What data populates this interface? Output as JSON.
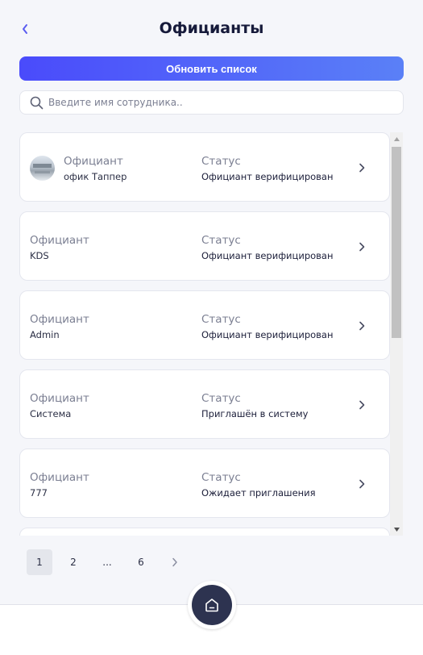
{
  "header": {
    "title": "Официанты",
    "back_icon": "chevron-left-icon",
    "accent_color": "#5a5cf0"
  },
  "refresh_button": {
    "label": "Обновить список",
    "gradient": [
      "#4a4bfb",
      "#5a80f7"
    ]
  },
  "search": {
    "placeholder": "Введите имя сотрудника..",
    "value": "",
    "icon": "search-icon"
  },
  "waiters": [
    {
      "role_label": "Официант",
      "name": "офик Таппер",
      "status_label": "Статус",
      "status": "Официант верифицирован",
      "has_avatar": true
    },
    {
      "role_label": "Официант",
      "name": "KDS",
      "status_label": "Статус",
      "status": "Официант верифицирован",
      "has_avatar": false
    },
    {
      "role_label": "Официант",
      "name": "Admin",
      "status_label": "Статус",
      "status": "Официант верифицирован",
      "has_avatar": false
    },
    {
      "role_label": "Официант",
      "name": "Система",
      "status_label": "Статус",
      "status": "Приглашён в систему",
      "has_avatar": false
    },
    {
      "role_label": "Официант",
      "name": "777",
      "status_label": "Статус",
      "status": "Ожидает приглашения",
      "has_avatar": false
    }
  ],
  "pagination": {
    "pages": [
      "1",
      "2",
      "...",
      "6"
    ],
    "current": "1",
    "next_icon": "chevron-right-icon"
  },
  "bottom_nav": {
    "home_icon": "home-icon",
    "home_color": "#2d3350"
  }
}
